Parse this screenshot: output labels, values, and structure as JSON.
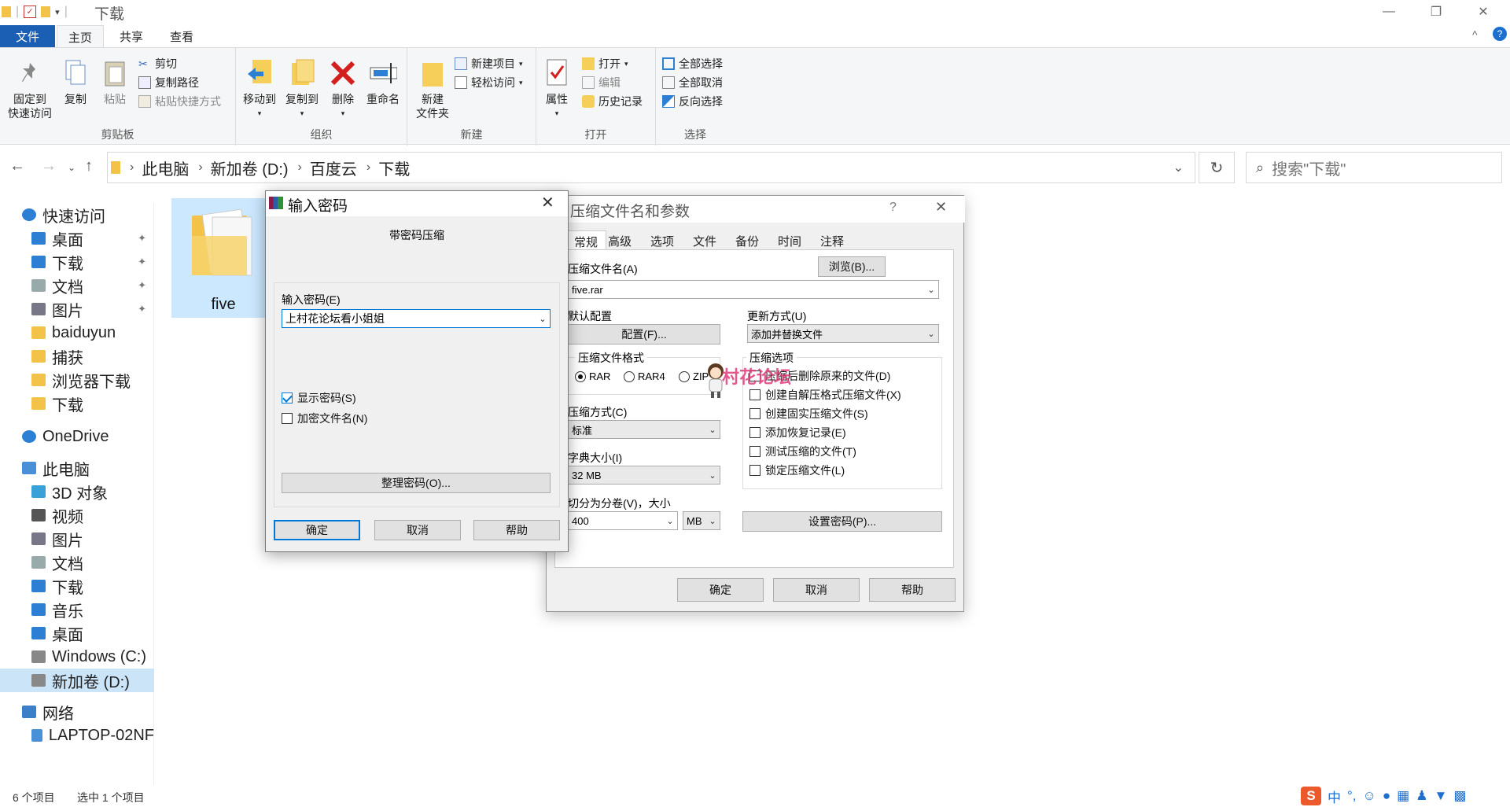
{
  "window": {
    "title": "下载",
    "minimize": "—",
    "maximize": "❐",
    "close": "✕"
  },
  "ribbon_tabs": [
    "文件",
    "主页",
    "共享",
    "查看"
  ],
  "ribbon": {
    "clipboard": {
      "pin": "固定到\n快速访问",
      "copy": "复制",
      "paste": "粘贴",
      "cut": "剪切",
      "copy_path": "复制路径",
      "paste_shortcut": "粘贴快捷方式",
      "label": "剪贴板"
    },
    "organize": {
      "move_to": "移动到",
      "copy_to": "复制到",
      "delete": "删除",
      "rename": "重命名",
      "label": "组织"
    },
    "new": {
      "new_folder": "新建\n文件夹",
      "new_item": "新建项目",
      "easy_access": "轻松访问",
      "label": "新建"
    },
    "open": {
      "properties": "属性",
      "open": "打开",
      "edit": "编辑",
      "history": "历史记录",
      "label": "打开"
    },
    "select": {
      "select_all": "全部选择",
      "select_none": "全部取消",
      "invert": "反向选择",
      "label": "选择"
    }
  },
  "address": {
    "crumbs": [
      "此电脑",
      "新加卷 (D:)",
      "百度云",
      "下载"
    ],
    "search_placeholder": "搜索\"下载\""
  },
  "sidebar": [
    {
      "label": "快速访问",
      "level": 0,
      "icon": "star-icon"
    },
    {
      "label": "桌面",
      "level": 1,
      "icon": "desktop-icon",
      "pinned": true
    },
    {
      "label": "下载",
      "level": 1,
      "icon": "download-icon",
      "pinned": true
    },
    {
      "label": "文档",
      "level": 1,
      "icon": "document-icon",
      "pinned": true
    },
    {
      "label": "图片",
      "level": 1,
      "icon": "picture-icon",
      "pinned": true
    },
    {
      "label": "baiduyun",
      "level": 1,
      "icon": "folder-icon"
    },
    {
      "label": "捕获",
      "level": 1,
      "icon": "folder-icon"
    },
    {
      "label": "浏览器下载",
      "level": 1,
      "icon": "folder-icon"
    },
    {
      "label": "下载",
      "level": 1,
      "icon": "folder-icon"
    },
    {
      "label": "OneDrive",
      "level": 0,
      "icon": "cloud-icon"
    },
    {
      "label": "此电脑",
      "level": 0,
      "icon": "computer-icon"
    },
    {
      "label": "3D 对象",
      "level": 1,
      "icon": "cube-icon"
    },
    {
      "label": "视频",
      "level": 1,
      "icon": "video-icon"
    },
    {
      "label": "图片",
      "level": 1,
      "icon": "picture-icon"
    },
    {
      "label": "文档",
      "level": 1,
      "icon": "document-icon"
    },
    {
      "label": "下载",
      "level": 1,
      "icon": "download-icon"
    },
    {
      "label": "音乐",
      "level": 1,
      "icon": "music-icon"
    },
    {
      "label": "桌面",
      "level": 1,
      "icon": "desktop-icon"
    },
    {
      "label": "Windows (C:)",
      "level": 1,
      "icon": "drive-icon"
    },
    {
      "label": "新加卷 (D:)",
      "level": 1,
      "icon": "drive-icon",
      "selected": true
    },
    {
      "label": "网络",
      "level": 0,
      "icon": "network-icon"
    },
    {
      "label": "LAPTOP-02NF",
      "level": 1,
      "icon": "computer-icon"
    }
  ],
  "files": [
    {
      "name": "five"
    }
  ],
  "status": {
    "count": "6 个项目",
    "selected": "选中 1 个项目"
  },
  "zip_dialog": {
    "title": "压缩文件名和参数",
    "help": "?",
    "tabs": [
      "常规",
      "高级",
      "选项",
      "文件",
      "备份",
      "时间",
      "注释"
    ],
    "archive_name_label": "压缩文件名(A)",
    "browse": "浏览(B)...",
    "archive_name": "five.rar",
    "default_profile_label": "默认配置",
    "profile_button": "配置(F)...",
    "update_mode_label": "更新方式(U)",
    "update_mode": "添加并替换文件",
    "format_label": "压缩文件格式",
    "formats": [
      "RAR",
      "RAR4",
      "ZIP"
    ],
    "method_label": "压缩方式(C)",
    "method": "标准",
    "dict_label": "字典大小(I)",
    "dict": "32 MB",
    "split_label": "切分为分卷(V)，大小",
    "split_value": "400",
    "split_unit": "MB",
    "options_label": "压缩选项",
    "options": [
      "压缩后删除原来的文件(D)",
      "创建自解压格式压缩文件(X)",
      "创建固实压缩文件(S)",
      "添加恢复记录(E)",
      "测试压缩的文件(T)",
      "锁定压缩文件(L)"
    ],
    "set_password": "设置密码(P)...",
    "ok": "确定",
    "cancel": "取消",
    "help_btn": "帮助",
    "watermark": "村花论坛"
  },
  "password_dialog": {
    "title": "输入密码",
    "subtitle": "带密码压缩",
    "field_label": "输入密码(E)",
    "password": "上村花论坛看小姐姐",
    "show_password": "显示密码(S)",
    "encrypt_names": "加密文件名(N)",
    "organize": "整理密码(O)...",
    "ok": "确定",
    "cancel": "取消",
    "help": "帮助"
  },
  "ime": {
    "lang": "中",
    "punct": "°,"
  }
}
